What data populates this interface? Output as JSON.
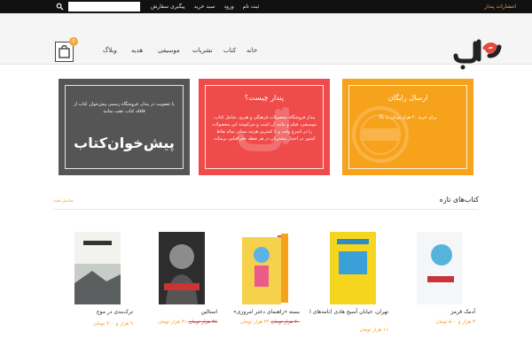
{
  "top_bar": {
    "search_placeholder": "",
    "links": [
      "ثبت نام",
      "ورود",
      "سبد خرید",
      "پیگیری سفارش"
    ],
    "store_link": "انتشارات پندار"
  },
  "header": {
    "logo_text": "پندار",
    "cart_count": "0",
    "nav": [
      "خانه",
      "کتاب",
      "نشریات",
      "موسیقی",
      "هدیه",
      "وبلاگ"
    ]
  },
  "promo_boxes": [
    {
      "title": "ارسال رایگان",
      "body": "برای خرید ۲۰ هزار تومان به بالا"
    },
    {
      "title": "پندار چیست؟",
      "body": "پندار فروشگاه محصولات فرهنگی و هنری، شامل کتاب، موسیقی، فیلم و مانند آن است و می‌کوشد این محصولات را در اسرع وقت و با کمترین هزینه ممکن تمام نقاط کشور در اختیار مشتریان در هر نقطه جغرافیایی برساند."
    },
    {
      "body": "با عضویت در پندار، فروشگاه رسمی پیش‌خوان کتاب از قافله کتاب عقب نمانید",
      "big": "پیش‌خوان‌کتاب"
    }
  ],
  "section": {
    "title": "کتاب‌های تازه",
    "show_all": "نمایش همه"
  },
  "products": [
    {
      "title": "ترک‌بندی در موج",
      "old": "",
      "new": "۹ هزار و ۴۰۰ تومان"
    },
    {
      "title": "استالین",
      "old": "۳۸ هزار تومان",
      "new": "۳۱ هزار تومان"
    },
    {
      "title": "بسته «راهنمای دختر امروزی»",
      "old": "۴۰ هزار تومان",
      "new": "۳۲ هزار تومان"
    },
    {
      "title": "تهران، خیابان آسیج هادی (نامه‌های ا",
      "old": "",
      "new": "۱۱ هزار تومان"
    },
    {
      "title": "آدمک قرمز",
      "old": "",
      "new": "۳ هزار و ۵۰۰ تومان"
    }
  ]
}
